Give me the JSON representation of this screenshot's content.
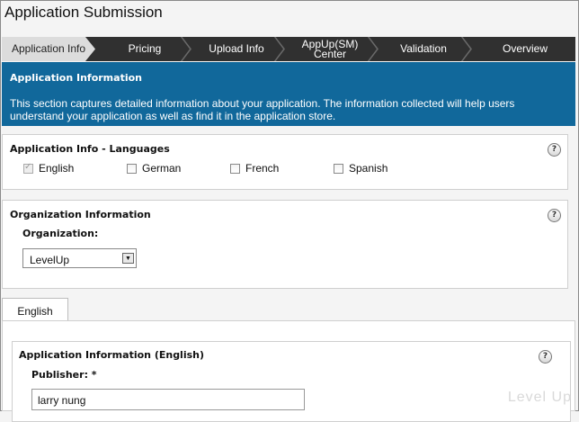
{
  "page": {
    "title": "Application Submission"
  },
  "steps": [
    {
      "label": "Application Info"
    },
    {
      "label": "Pricing"
    },
    {
      "label": "Upload Info"
    },
    {
      "label": "AppUp(SM) Center"
    },
    {
      "label": "Validation"
    },
    {
      "label": "Overview"
    }
  ],
  "info": {
    "title": "Application Information",
    "description": "This section captures detailed information about your application. The information collected will help users understand your application as well as find it in the application store."
  },
  "languages": {
    "title": "Application Info - Languages",
    "options": [
      {
        "label": "English",
        "checked": true
      },
      {
        "label": "German",
        "checked": false
      },
      {
        "label": "French",
        "checked": false
      },
      {
        "label": "Spanish",
        "checked": false
      }
    ]
  },
  "organization": {
    "title": "Organization Information",
    "field_label": "Organization:",
    "selected": "LevelUp"
  },
  "tabs": [
    {
      "label": "English"
    }
  ],
  "app_info_english": {
    "title": "Application Information (English)",
    "publisher_label": "Publisher: *",
    "publisher_value": "larry nung"
  },
  "help_label": "?",
  "watermark": "Level Up",
  "colors": {
    "info_bg": "#11689b",
    "step_bar": "#303030",
    "active_step": "#dcdcdc"
  },
  "icons": {
    "help": "question-mark-circle-icon",
    "dropdown": "triangle-down-icon"
  }
}
